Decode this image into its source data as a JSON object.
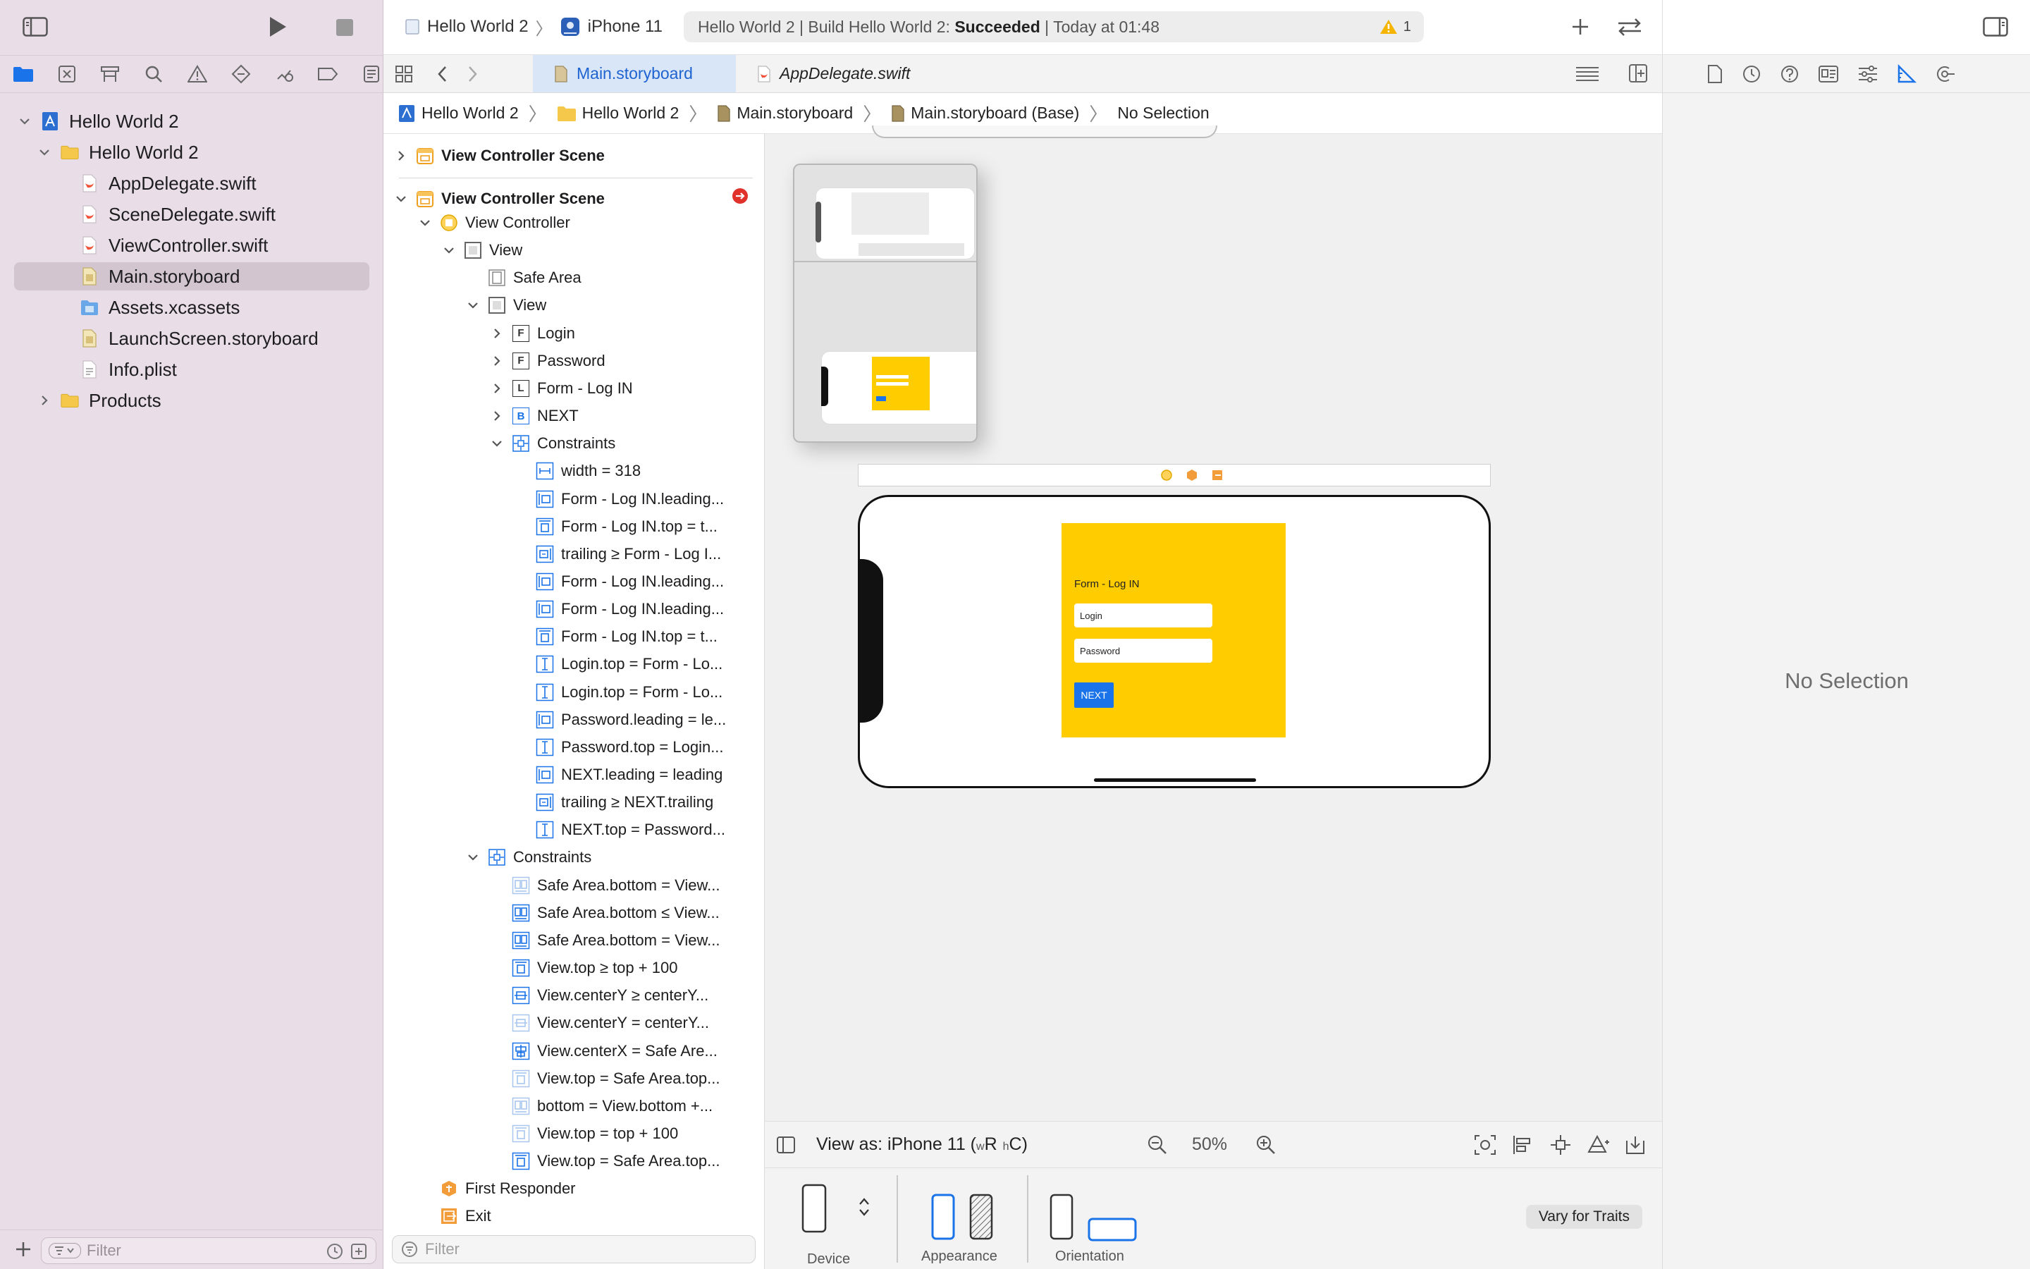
{
  "navigator": {
    "items": [
      {
        "label": "Hello World 2",
        "icon": "xcode-project-icon",
        "level": 0,
        "expanded": true,
        "selected": false
      },
      {
        "label": "Hello World 2",
        "icon": "folder-icon",
        "level": 1,
        "expanded": true,
        "selected": false
      },
      {
        "label": "AppDelegate.swift",
        "icon": "swift-file-icon",
        "level": 2,
        "selected": false
      },
      {
        "label": "SceneDelegate.swift",
        "icon": "swift-file-icon",
        "level": 2,
        "selected": false
      },
      {
        "label": "ViewController.swift",
        "icon": "swift-file-icon",
        "level": 2,
        "selected": false
      },
      {
        "label": "Main.storyboard",
        "icon": "storyboard-file-icon",
        "level": 2,
        "selected": true
      },
      {
        "label": "Assets.xcassets",
        "icon": "asset-catalog-icon",
        "level": 2,
        "selected": false
      },
      {
        "label": "LaunchScreen.storyboard",
        "icon": "storyboard-file-icon",
        "level": 2,
        "selected": false
      },
      {
        "label": "Info.plist",
        "icon": "plist-file-icon",
        "level": 2,
        "selected": false
      },
      {
        "label": "Products",
        "icon": "folder-icon",
        "level": 1,
        "expanded": false,
        "selected": false
      }
    ],
    "filter_placeholder": "Filter"
  },
  "toolbar": {
    "scheme_project": "Hello World 2",
    "scheme_device": "iPhone 11",
    "activity_prefix": "Hello World 2 | Build Hello World 2: ",
    "activity_status": "Succeeded",
    "activity_time": " | Today at 01:48",
    "warning_count": "1"
  },
  "tabs": [
    {
      "label": "Main.storyboard",
      "active": true
    },
    {
      "label": "AppDelegate.swift",
      "active": false
    }
  ],
  "jumpbar": [
    "Hello World 2",
    "Hello World 2",
    "Main.storyboard",
    "Main.storyboard (Base)",
    "No Selection"
  ],
  "outline": {
    "rows": [
      {
        "label": "View Controller Scene",
        "level": 0,
        "chevron": "right",
        "icon": "scene-icon",
        "bold": true
      },
      {
        "label": "View Controller Scene",
        "level": 0,
        "chevron": "down",
        "icon": "scene-icon",
        "bold": true
      },
      {
        "label": "View Controller",
        "level": 1,
        "chevron": "down",
        "icon": "view-controller-icon"
      },
      {
        "label": "View",
        "level": 2,
        "chevron": "down",
        "icon": "view-icon"
      },
      {
        "label": "Safe Area",
        "level": 3,
        "chevron": "",
        "icon": "safe-area-icon"
      },
      {
        "label": "View",
        "level": 3,
        "chevron": "down",
        "icon": "view-icon"
      },
      {
        "label": "Login",
        "level": 4,
        "chevron": "right",
        "icon": "textfield-icon",
        "glyph": "F"
      },
      {
        "label": "Password",
        "level": 4,
        "chevron": "right",
        "icon": "textfield-icon",
        "glyph": "F"
      },
      {
        "label": "Form - Log IN",
        "level": 4,
        "chevron": "right",
        "icon": "label-icon",
        "glyph": "L"
      },
      {
        "label": "NEXT",
        "level": 4,
        "chevron": "right",
        "icon": "button-icon",
        "glyph": "B"
      },
      {
        "label": "Constraints",
        "level": 4,
        "chevron": "down",
        "icon": "constraints-icon"
      },
      {
        "label": "width = 318",
        "level": 5,
        "chevron": "",
        "icon": "constraint-width-icon"
      },
      {
        "label": "Form - Log IN.leading...",
        "level": 5,
        "chevron": "",
        "icon": "constraint-leading-icon"
      },
      {
        "label": "Form - Log IN.top = t...",
        "level": 5,
        "chevron": "",
        "icon": "constraint-top-icon"
      },
      {
        "label": "trailing ≥ Form - Log I...",
        "level": 5,
        "chevron": "",
        "icon": "constraint-trailing-icon"
      },
      {
        "label": "Form - Log IN.leading...",
        "level": 5,
        "chevron": "",
        "icon": "constraint-leading-icon"
      },
      {
        "label": "Form - Log IN.leading...",
        "level": 5,
        "chevron": "",
        "icon": "constraint-leading-icon"
      },
      {
        "label": "Form - Log IN.top = t...",
        "level": 5,
        "chevron": "",
        "icon": "constraint-top-icon"
      },
      {
        "label": "Login.top = Form - Lo...",
        "level": 5,
        "chevron": "",
        "icon": "constraint-vspace-icon"
      },
      {
        "label": "Login.top = Form - Lo...",
        "level": 5,
        "chevron": "",
        "icon": "constraint-vspace-icon"
      },
      {
        "label": "Password.leading = le...",
        "level": 5,
        "chevron": "",
        "icon": "constraint-leading-icon"
      },
      {
        "label": "Password.top = Login...",
        "level": 5,
        "chevron": "",
        "icon": "constraint-vspace-icon"
      },
      {
        "label": "NEXT.leading = leading",
        "level": 5,
        "chevron": "",
        "icon": "constraint-leading-icon"
      },
      {
        "label": "trailing ≥ NEXT.trailing",
        "level": 5,
        "chevron": "",
        "icon": "constraint-trailing-icon"
      },
      {
        "label": "NEXT.top = Password...",
        "level": 5,
        "chevron": "",
        "icon": "constraint-vspace-icon"
      },
      {
        "label": "Constraints",
        "level": 3,
        "chevron": "down",
        "icon": "constraints-icon"
      },
      {
        "label": "Safe Area.bottom = View...",
        "level": 4,
        "chevron": "",
        "icon": "constraint-bottom-faded-icon"
      },
      {
        "label": "Safe Area.bottom ≤ View...",
        "level": 4,
        "chevron": "",
        "icon": "constraint-bottom-icon"
      },
      {
        "label": "Safe Area.bottom = View...",
        "level": 4,
        "chevron": "",
        "icon": "constraint-bottom-icon"
      },
      {
        "label": "View.top ≥ top + 100",
        "level": 4,
        "chevron": "",
        "icon": "constraint-top-icon"
      },
      {
        "label": "View.centerY ≥ centerY...",
        "level": 4,
        "chevron": "",
        "icon": "constraint-centery-icon"
      },
      {
        "label": "View.centerY = centerY...",
        "level": 4,
        "chevron": "",
        "icon": "constraint-centery-faded-icon"
      },
      {
        "label": "View.centerX = Safe Are...",
        "level": 4,
        "chevron": "",
        "icon": "constraint-centerx-icon"
      },
      {
        "label": "View.top = Safe Area.top...",
        "level": 4,
        "chevron": "",
        "icon": "constraint-top-faded-icon"
      },
      {
        "label": "bottom = View.bottom +...",
        "level": 4,
        "chevron": "",
        "icon": "constraint-bottom-faded-icon"
      },
      {
        "label": "View.top = top + 100",
        "level": 4,
        "chevron": "",
        "icon": "constraint-top-faded-icon"
      },
      {
        "label": "View.top = Safe Area.top...",
        "level": 4,
        "chevron": "",
        "icon": "constraint-top-icon"
      },
      {
        "label": "First Responder",
        "level": 1,
        "chevron": "",
        "icon": "first-responder-icon"
      },
      {
        "label": "Exit",
        "level": 1,
        "chevron": "",
        "icon": "exit-icon"
      }
    ],
    "filter_placeholder": "Filter"
  },
  "canvas": {
    "form_title": "Form - Log IN",
    "login_placeholder": "Login",
    "password_placeholder": "Password",
    "next_label": "NEXT",
    "view_as_prefix": "View as: iPhone 11 (",
    "view_as_w": "w",
    "view_as_R": "R",
    "view_as_h": "h",
    "view_as_C": "C",
    "view_as_suffix": ")",
    "zoom": "50%",
    "device_label": "Device",
    "appearance_label": "Appearance",
    "orientation_label": "Orientation",
    "vary_label": "Vary for Traits"
  },
  "inspector": {
    "empty_text": "No Selection"
  },
  "colors": {
    "accent": "#1e63d0",
    "form_yellow": "#ffcc00",
    "next_blue": "#1a73e8",
    "warning": "#f5b400",
    "error_red": "#e0312b"
  }
}
